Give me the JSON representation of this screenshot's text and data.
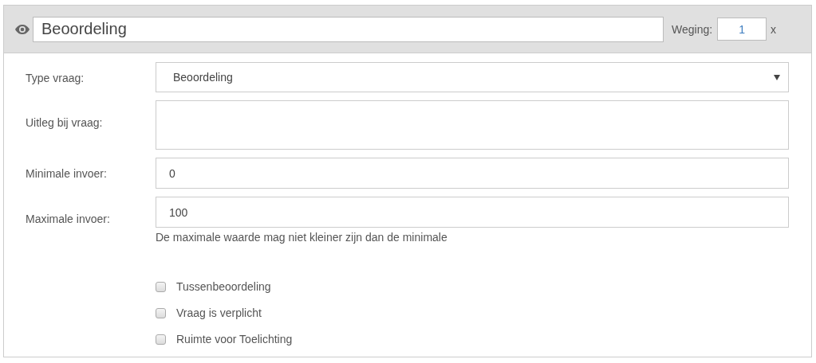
{
  "header": {
    "title_field": {
      "value": "Beoordeling"
    },
    "weight_label": "Weging:",
    "weight_field": {
      "value": "1"
    },
    "weight_suffix": "x"
  },
  "fields": [
    {
      "kind": "select",
      "label": "Type vraag:",
      "value": "Beoordeling"
    },
    {
      "kind": "textarea",
      "label": "Uitleg bij vraag:"
    },
    {
      "kind": "input",
      "label": "Minimale invoer:",
      "value": "0"
    },
    {
      "kind": "input",
      "label": "Maximale invoer:",
      "value": "100",
      "help": "De maximale waarde mag niet kleiner zijn dan de minimale"
    }
  ],
  "checkboxes": [
    {
      "label": "Tussenbeoordeling",
      "checked": false
    },
    {
      "label": "Vraag is verplicht",
      "checked": false
    },
    {
      "label": "Ruimte voor Toelichting",
      "checked": false
    }
  ]
}
